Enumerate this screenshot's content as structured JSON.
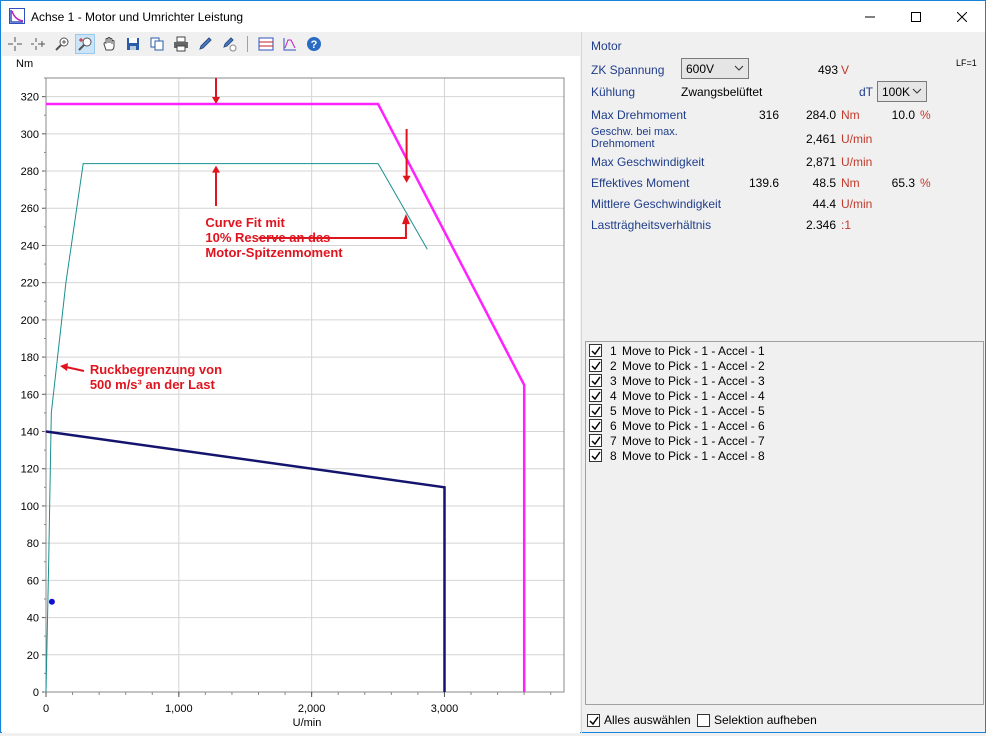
{
  "window": {
    "title": "Achse 1 - Motor und Umrichter Leistung"
  },
  "toolbar": {
    "icons": [
      "crosshair-icon",
      "crosshair-plus-icon",
      "zoom-icon",
      "zoom-move-icon",
      "hand-icon",
      "save-icon",
      "copy-icon",
      "print-icon",
      "pen-icon",
      "pen-clear-icon",
      "chart-settings-icon",
      "curve-icon",
      "help-icon"
    ]
  },
  "panel": {
    "section": "Motor",
    "lf": "LF=1",
    "zk_label": "ZK Spannung",
    "zk_select": "600V",
    "zk_value": "493",
    "zk_unit": "V",
    "cooling_label": "Kühlung",
    "cooling_value": "Zwangsbelüftet",
    "dt_label": "dT",
    "dt_select": "100K",
    "max_torque_label": "Max Drehmoment",
    "max_torque_motor": "316",
    "max_torque_value": "284.0",
    "max_torque_unit": "Nm",
    "max_torque_pct": "10.0",
    "max_torque_pct_unit": "%",
    "speed_at_max_label_1": "Geschw. bei max.",
    "speed_at_max_label_2": "Drehmoment",
    "speed_at_max_value": "2,461",
    "speed_at_max_unit": "U/min",
    "max_speed_label": "Max Geschwindigkeit",
    "max_speed_value": "2,871",
    "max_speed_unit": "U/min",
    "eff_moment_label": "Effektives Moment",
    "eff_moment_motor": "139.6",
    "eff_moment_value": "48.5",
    "eff_moment_unit": "Nm",
    "eff_moment_pct": "65.3",
    "eff_moment_pct_unit": "%",
    "mean_speed_label": "Mittlere Geschwindigkeit",
    "mean_speed_value": "44.4",
    "mean_speed_unit": "U/min",
    "inertia_label": "Lastträgheitsverhältnis",
    "inertia_value": "2.346",
    "inertia_unit": ":1"
  },
  "moves": [
    {
      "num": "1",
      "label": "Move to Pick - 1 - Accel - 1",
      "checked": true
    },
    {
      "num": "2",
      "label": "Move to Pick - 1 - Accel - 2",
      "checked": true
    },
    {
      "num": "3",
      "label": "Move to Pick - 1 - Accel - 3",
      "checked": true
    },
    {
      "num": "4",
      "label": "Move to Pick - 1 - Accel - 4",
      "checked": true
    },
    {
      "num": "5",
      "label": "Move to Pick - 1 - Accel - 5",
      "checked": true
    },
    {
      "num": "6",
      "label": "Move to Pick - 1 - Accel - 6",
      "checked": true
    },
    {
      "num": "7",
      "label": "Move to Pick - 1 - Accel - 7",
      "checked": true
    },
    {
      "num": "8",
      "label": "Move to Pick - 1 - Accel - 8",
      "checked": true
    }
  ],
  "bottom": {
    "select_all": "Alles auswählen",
    "deselect": "Selektion aufheben"
  },
  "colors": {
    "peak": "#ff22ff",
    "fit": "#1a8f8f",
    "continuous": "#14146e",
    "annotation": "#e0141e",
    "point": "#1010d0"
  },
  "chart_data": {
    "type": "line",
    "ylabel": "Nm",
    "xlabel": "U/min",
    "xlim": [
      0,
      3900
    ],
    "ylim": [
      0,
      330
    ],
    "xticks": [
      0,
      1000,
      2000,
      3000
    ],
    "xtick_labels": [
      "0",
      "1,000",
      "2,000",
      "3,000"
    ],
    "yticks": [
      0,
      20,
      40,
      60,
      80,
      100,
      120,
      140,
      160,
      180,
      200,
      220,
      240,
      260,
      280,
      300,
      320
    ],
    "grid": true,
    "series": [
      {
        "name": "peak",
        "color": "#ff22ff",
        "width": 2.5,
        "points": [
          [
            0,
            316
          ],
          [
            2500,
            316
          ],
          [
            3600,
            165
          ],
          [
            3600,
            0
          ]
        ]
      },
      {
        "name": "fit",
        "color": "#1a8f8f",
        "width": 1,
        "points": [
          [
            0,
            0
          ],
          [
            20,
            70
          ],
          [
            40,
            150
          ],
          [
            150,
            220
          ],
          [
            280,
            284
          ],
          [
            2500,
            284
          ],
          [
            2871,
            238
          ]
        ]
      },
      {
        "name": "continuous",
        "color": "#14146e",
        "width": 2.5,
        "points": [
          [
            0,
            140
          ],
          [
            3000,
            110
          ],
          [
            3000,
            0
          ]
        ]
      }
    ],
    "point": {
      "x": 44.4,
      "y": 48.5
    },
    "annotations": [
      {
        "lines": [
          "Curve Fit mit",
          "10% Reserve an das",
          "Motor-Spitzenmoment"
        ],
        "x": 1200,
        "y": 250
      },
      {
        "lines": [
          "Ruckbegrenzung von",
          "500 m/s³ an der Last"
        ],
        "x": 330,
        "y": 171
      }
    ]
  }
}
